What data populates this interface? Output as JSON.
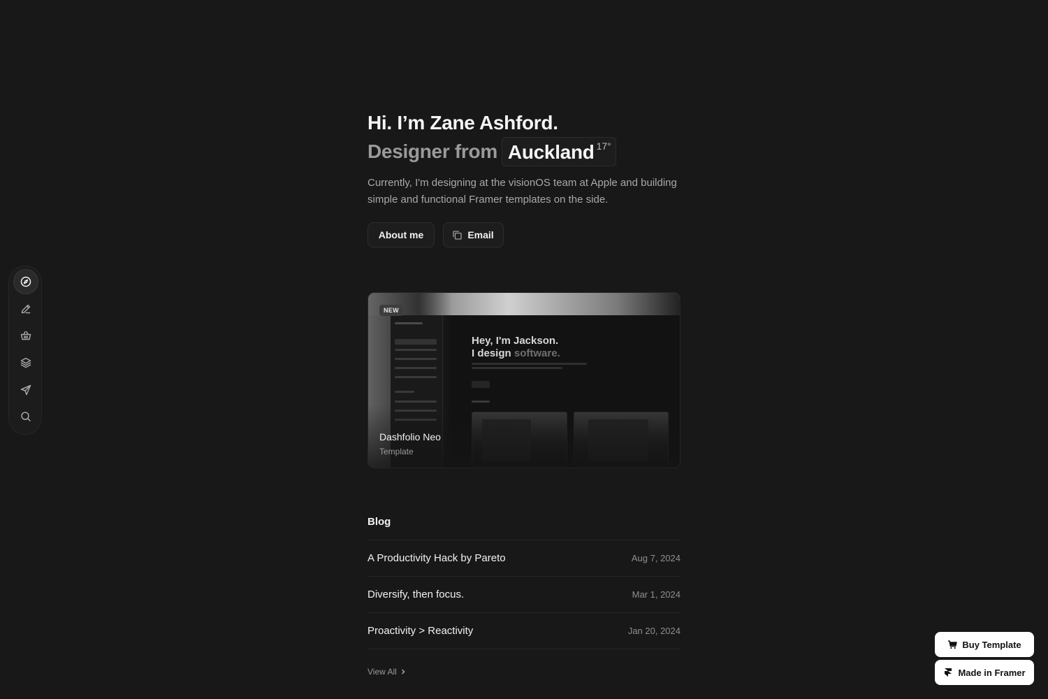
{
  "hero": {
    "greeting": "Hi. I’m Zane Ashford.",
    "role_prefix": "Designer from",
    "city": "Auckland",
    "temperature": "17°",
    "intro": "Currently, I'm designing at the visionOS team at Apple and building simple and functional Framer templates on the side."
  },
  "actions": {
    "about": "About me",
    "email": "Email"
  },
  "sidebar": {
    "items": [
      {
        "icon": "compass-icon",
        "active": true
      },
      {
        "icon": "pencil-icon",
        "active": false
      },
      {
        "icon": "basket-icon",
        "active": false
      },
      {
        "icon": "layers-icon",
        "active": false
      },
      {
        "icon": "send-icon",
        "active": false
      },
      {
        "icon": "search-icon",
        "active": false
      }
    ]
  },
  "featured": {
    "badge": "NEW",
    "title": "Dashfolio Neo",
    "subtitle": "Template",
    "preview": {
      "headline_1": "Hey, I'm Jackson.",
      "headline_2a": "I design",
      "headline_2b": "software."
    }
  },
  "blog": {
    "heading": "Blog",
    "posts": [
      {
        "title": "A Productivity Hack by Pareto",
        "date": "Aug 7, 2024"
      },
      {
        "title": "Diversify, then focus.",
        "date": "Mar 1, 2024"
      },
      {
        "title": "Proactivity > Reactivity",
        "date": "Jan 20, 2024"
      }
    ],
    "view_all": "View All"
  },
  "floating": {
    "buy": "Buy Template",
    "framer": "Made in Framer"
  }
}
